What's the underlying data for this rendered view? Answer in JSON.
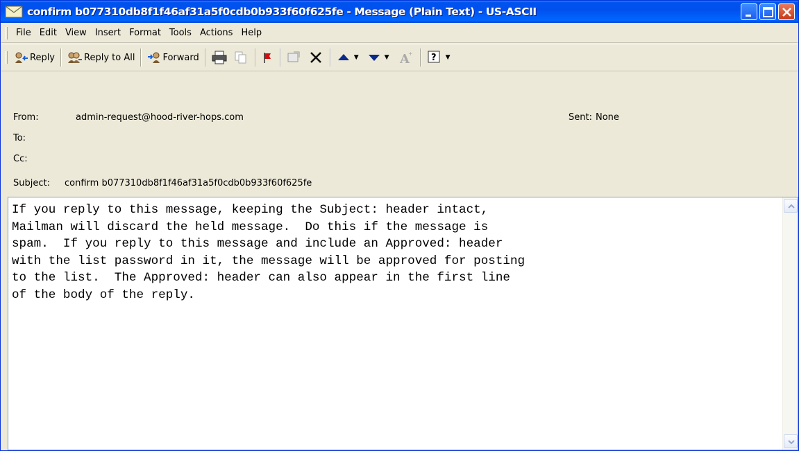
{
  "window": {
    "title": "confirm b077310db8f1f46af31a5f0cdb0b933f60f625fe - Message (Plain Text)  - US-ASCII"
  },
  "menu": [
    "File",
    "Edit",
    "View",
    "Insert",
    "Format",
    "Tools",
    "Actions",
    "Help"
  ],
  "toolbar": {
    "reply": "Reply",
    "reply_all": "Reply to All",
    "forward": "Forward"
  },
  "headers": {
    "from_label": "From:",
    "from_value": "admin-request@hood-river-hops.com",
    "sent_label": "Sent:",
    "sent_value": "None",
    "to_label": "To:",
    "to_value": "",
    "cc_label": "Cc:",
    "cc_value": "",
    "subject_label": "Subject:",
    "subject_value": "confirm b077310db8f1f46af31a5f0cdb0b933f60f625fe"
  },
  "body": {
    "text": "If you reply to this message, keeping the Subject: header intact,\nMailman will discard the held message.  Do this if the message is\nspam.  If you reply to this message and include an Approved: header\nwith the list password in it, the message will be approved for posting\nto the list.  The Approved: header can also appear in the first line\nof the body of the reply."
  },
  "colors": {
    "titlebar": "#0054e3",
    "close_button": "#c63a15",
    "chrome": "#ece9d8"
  }
}
